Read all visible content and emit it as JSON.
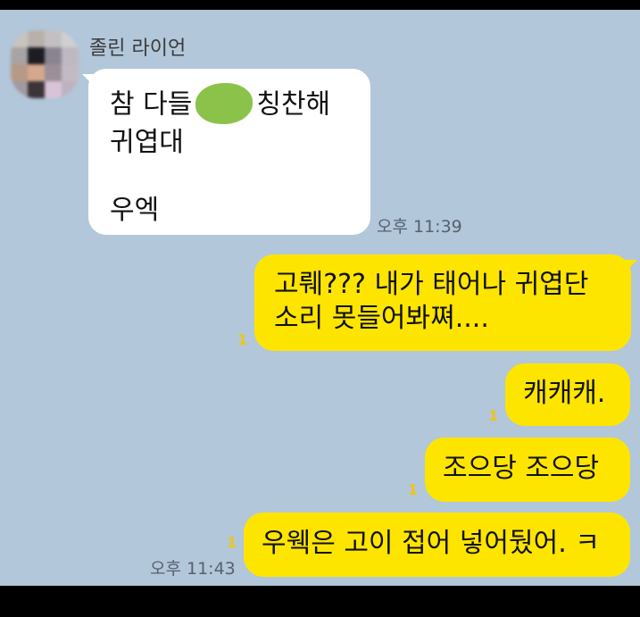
{
  "sender": {
    "name": "졸린 라이언"
  },
  "incoming": {
    "line1_a": "참 다들",
    "line1_b": "칭찬해",
    "line2": "귀엽대",
    "line3": "우엑",
    "time": "오후 11:39"
  },
  "outgoing": [
    {
      "line1": "고뤠??? 내가 태어나 귀엽단",
      "line2": "소리 못들어봐쪄....",
      "unread": "1"
    },
    {
      "text": "캐캐캐.",
      "unread": "1"
    },
    {
      "text": "조으당 조으당",
      "unread": "1"
    },
    {
      "text": "우웩은 고이 접어 넣어뒀어. ㅋ",
      "unread": "1",
      "time": "오후 11:43"
    }
  ],
  "colors": {
    "chat_bg": "#b2c7d9",
    "outgoing_bubble": "#fee500",
    "incoming_bubble": "#ffffff",
    "unread_count": "#f1c40f"
  }
}
